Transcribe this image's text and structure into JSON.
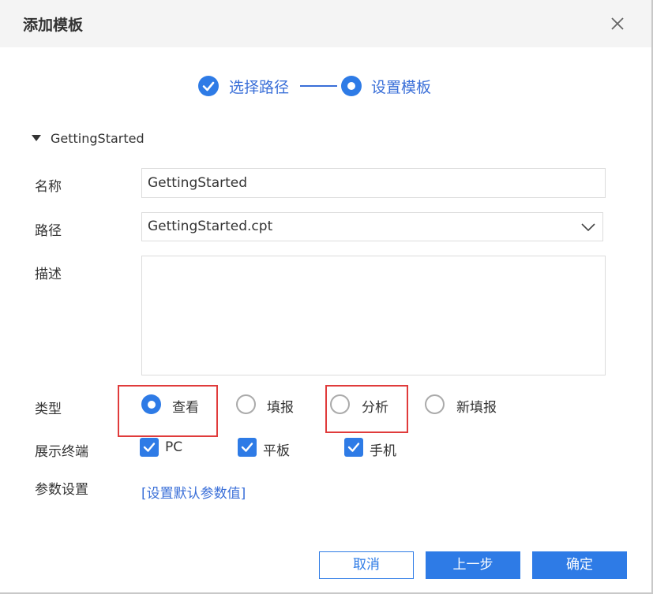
{
  "dialog": {
    "title": "添加模板"
  },
  "steps": [
    {
      "label": "选择路径",
      "state": "done"
    },
    {
      "label": "设置模板",
      "state": "current"
    }
  ],
  "section": {
    "title": "GettingStarted"
  },
  "form": {
    "name_label": "名称",
    "name_value": "GettingStarted",
    "path_label": "路径",
    "path_value": "GettingStarted.cpt",
    "desc_label": "描述",
    "desc_value": "",
    "type_label": "类型",
    "type_options": [
      {
        "label": "查看",
        "selected": true
      },
      {
        "label": "填报",
        "selected": false
      },
      {
        "label": "分析",
        "selected": false
      },
      {
        "label": "新填报",
        "selected": false
      }
    ],
    "terminal_label": "展示终端",
    "terminal_options": [
      {
        "label": "PC",
        "checked": true
      },
      {
        "label": "平板",
        "checked": true
      },
      {
        "label": "手机",
        "checked": true
      }
    ],
    "params_label": "参数设置",
    "params_link": "[设置默认参数值]"
  },
  "buttons": {
    "cancel": "取消",
    "prev": "上一步",
    "confirm": "确定"
  },
  "colors": {
    "accent": "#2e7be6",
    "highlight": "#e03b3b"
  }
}
